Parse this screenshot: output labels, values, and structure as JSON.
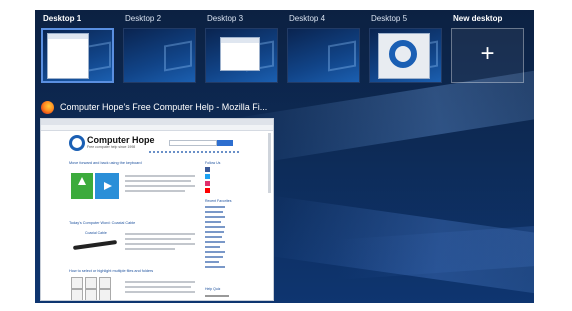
{
  "task_view": {
    "desktops": [
      {
        "label": "Desktop 1",
        "active": true
      },
      {
        "label": "Desktop 2",
        "active": false
      },
      {
        "label": "Desktop 3",
        "active": false
      },
      {
        "label": "Desktop 4",
        "active": false
      },
      {
        "label": "Desktop 5",
        "active": false
      }
    ],
    "new_desktop": {
      "label": "New desktop",
      "icon": "plus-icon"
    }
  },
  "window": {
    "title": "Computer Hope's Free Computer Help - Mozilla Fi...",
    "icon": "firefox-icon",
    "page": {
      "brand": "Computer Hope",
      "brand_sub": "Free computer help since 1998",
      "articles": [
        "Move forward and back using the keyboard",
        "Today's Computer Word: Coaxial Cable",
        "How to select or highlight multiple files and folders"
      ],
      "cable_label": "Coaxial Cable",
      "side_follow": "Follow Us",
      "side_recent": "Recent Favorites",
      "side_help": "Help Quiz"
    }
  },
  "colors": {
    "accent": "#5a8fe0",
    "background": "#0d2a55"
  }
}
